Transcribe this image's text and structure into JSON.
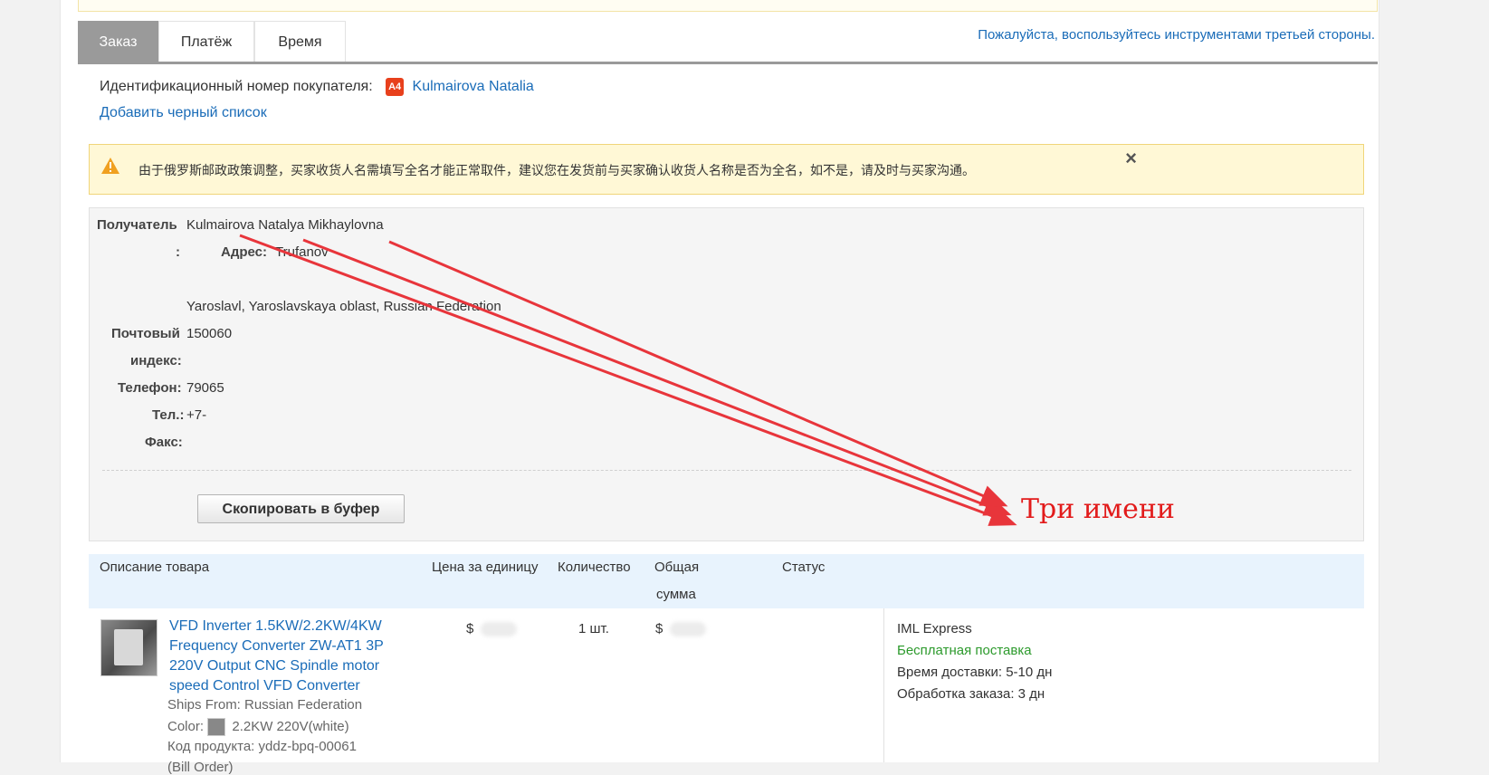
{
  "tabs": [
    {
      "label": "Заказ",
      "active": true
    },
    {
      "label": "Платёж",
      "active": false
    },
    {
      "label": "Время",
      "active": false
    }
  ],
  "third_party_link": "Пожалуйста, воспользуйтесь инструментами третьей стороны.",
  "buyer": {
    "label": "Идентификационный номер покупателя:",
    "badge": "A4",
    "name": "Kulmairova Natalia",
    "blacklist_link": "Добавить черный список"
  },
  "notice": {
    "text": "由于俄罗斯邮政政策调整，买家收货人名需填写全名才能正常取件，建议您在发货前与买家确认收货人名称是否为全名，如不是，请及时与买家沟通。",
    "close": "×"
  },
  "recipient": {
    "recipient_label": "Получатель",
    "recipient_colon": ":",
    "recipient_name": "Kulmairova Natalya Mikhaylovna",
    "address_label": "Адрес:",
    "address_line1": "Trufanov",
    "address_line2": "Yaroslavl, Yaroslavskaya oblast, Russian Federation",
    "zip_label_1": "Почтовый",
    "zip_label_2": "индекс:",
    "zip_value": "150060",
    "phone_label": "Телефон:",
    "phone_value": "79065",
    "tel_label": "Тел.:",
    "tel_value": "+7-",
    "fax_label": "Факс:",
    "copy_button": "Скопировать в буфер"
  },
  "annotation": {
    "text": "Три имени",
    "color": "#e21b1b"
  },
  "table": {
    "headers": {
      "description": "Описание товара",
      "unit_price": "Цена за единицу",
      "quantity": "Количество",
      "total_1": "Общая",
      "total_2": "сумма",
      "status": "Статус"
    },
    "row": {
      "title_lines": [
        "VFD Inverter 1.5KW/2.2KW/4KW",
        "Frequency Converter ZW-AT1 3P",
        "220V Output CNC Spindle motor",
        "speed Control VFD Converter"
      ],
      "ships_from": "Ships From: Russian Federation",
      "color_label": "Color:",
      "color_value": "2.2KW 220V(white)",
      "sku": "Код продукта: yddz-bpq-00061",
      "extra": "(Bill Order)",
      "unit_price_currency": "$",
      "quantity": "1 шт.",
      "total_currency": "$",
      "carrier": "IML Express",
      "free_shipping": "Бесплатная поставка",
      "delivery_label": "Время доставки:",
      "delivery_value": "5-10 дн",
      "processing_label": "Обработка заказа:",
      "processing_value": "3 дн"
    }
  },
  "colors": {
    "link": "#1a6cb8",
    "tab_active": "#9a9a9a",
    "notice_bg": "#fff8d6",
    "free_shipping": "#2c9a2c",
    "table_head_bg": "#e8f3fd"
  }
}
